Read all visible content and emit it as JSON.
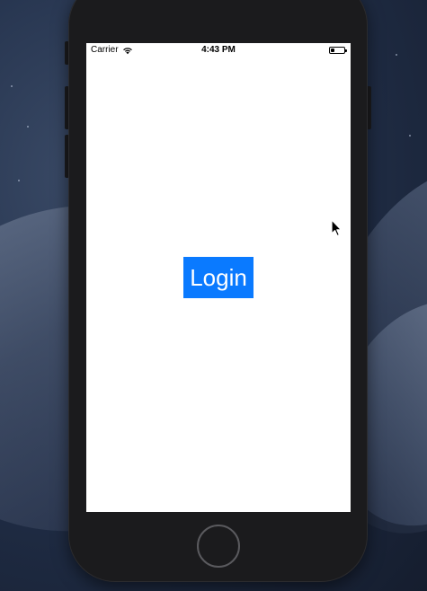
{
  "status_bar": {
    "carrier": "Carrier",
    "time": "4:43 PM",
    "battery_level": 0.3,
    "icons": [
      "wifi-icon",
      "battery-icon"
    ]
  },
  "main": {
    "login_label": "Login"
  },
  "colors": {
    "accent": "#0a7aff",
    "screen_background": "#ffffff",
    "device_body": "#1b1b1d"
  },
  "device": {
    "icons": [
      "home-button",
      "cursor-icon"
    ]
  }
}
